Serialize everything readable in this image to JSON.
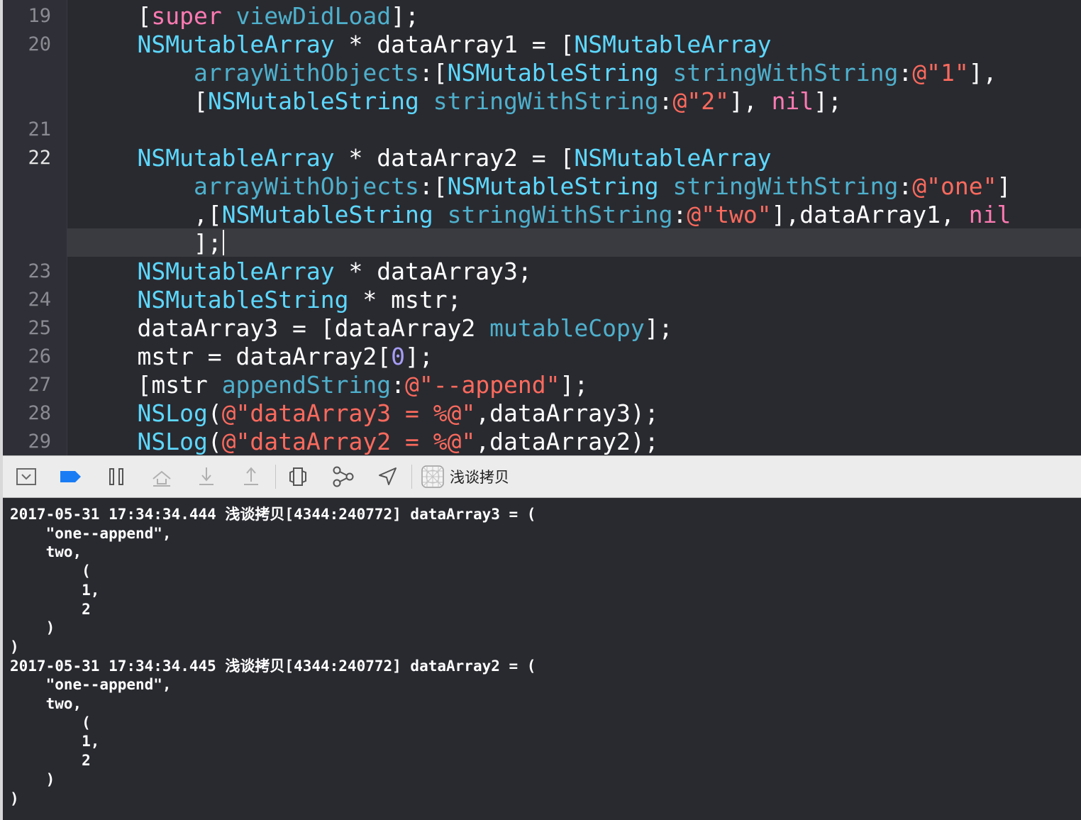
{
  "editor": {
    "current_line": "22",
    "rows": [
      {
        "line": "19",
        "active": false,
        "tokens": [
          [
            "p",
            "    ["
          ],
          [
            "k",
            "super"
          ],
          [
            "p",
            " "
          ],
          [
            "m",
            "viewDidLoad"
          ],
          [
            "p",
            "];"
          ]
        ]
      },
      {
        "line": "20",
        "active": false,
        "tokens": [
          [
            "t",
            "    NSMutableArray"
          ],
          [
            "p",
            " * dataArray1 = ["
          ],
          [
            "t",
            "NSMutableArray"
          ]
        ]
      },
      {
        "line": "",
        "active": false,
        "tokens": [
          [
            "m",
            "        arrayWithObjects"
          ],
          [
            "p",
            ":["
          ],
          [
            "t",
            "NSMutableString"
          ],
          [
            "p",
            " "
          ],
          [
            "m",
            "stringWithString"
          ],
          [
            "p",
            ":"
          ],
          [
            "s",
            "@\"1\""
          ],
          [
            "p",
            "],"
          ]
        ]
      },
      {
        "line": "",
        "active": false,
        "tokens": [
          [
            "p",
            "        ["
          ],
          [
            "t",
            "NSMutableString"
          ],
          [
            "p",
            " "
          ],
          [
            "m",
            "stringWithString"
          ],
          [
            "p",
            ":"
          ],
          [
            "s",
            "@\"2\""
          ],
          [
            "p",
            "], "
          ],
          [
            "k",
            "nil"
          ],
          [
            "p",
            "];"
          ]
        ]
      },
      {
        "line": "21",
        "active": false,
        "tokens": []
      },
      {
        "line": "22",
        "active": true,
        "tokens": [
          [
            "t",
            "    NSMutableArray"
          ],
          [
            "p",
            " * dataArray2 = ["
          ],
          [
            "t",
            "NSMutableArray"
          ]
        ]
      },
      {
        "line": "",
        "active": false,
        "tokens": [
          [
            "m",
            "        arrayWithObjects"
          ],
          [
            "p",
            ":["
          ],
          [
            "t",
            "NSMutableString"
          ],
          [
            "p",
            " "
          ],
          [
            "m",
            "stringWithString"
          ],
          [
            "p",
            ":"
          ],
          [
            "s",
            "@\"one\""
          ],
          [
            "p",
            "]"
          ]
        ]
      },
      {
        "line": "",
        "active": false,
        "tokens": [
          [
            "p",
            "        ,["
          ],
          [
            "t",
            "NSMutableString"
          ],
          [
            "p",
            " "
          ],
          [
            "m",
            "stringWithString"
          ],
          [
            "p",
            ":"
          ],
          [
            "s",
            "@\"two\""
          ],
          [
            "p",
            "],dataArray1, "
          ],
          [
            "k",
            "nil"
          ]
        ]
      },
      {
        "line": "",
        "active": false,
        "cursor": true,
        "tokens": [
          [
            "p",
            "        ];"
          ]
        ]
      },
      {
        "line": "23",
        "active": false,
        "tokens": [
          [
            "t",
            "    NSMutableArray"
          ],
          [
            "p",
            " * dataArray3;"
          ]
        ]
      },
      {
        "line": "24",
        "active": false,
        "tokens": [
          [
            "t",
            "    NSMutableString"
          ],
          [
            "p",
            " * mstr;"
          ]
        ]
      },
      {
        "line": "25",
        "active": false,
        "tokens": [
          [
            "p",
            "    dataArray3 = [dataArray2 "
          ],
          [
            "m",
            "mutableCopy"
          ],
          [
            "p",
            "];"
          ]
        ]
      },
      {
        "line": "26",
        "active": false,
        "tokens": [
          [
            "p",
            "    mstr = dataArray2["
          ],
          [
            "n",
            "0"
          ],
          [
            "p",
            "];"
          ]
        ]
      },
      {
        "line": "27",
        "active": false,
        "tokens": [
          [
            "p",
            "    [mstr "
          ],
          [
            "m",
            "appendString"
          ],
          [
            "p",
            ":"
          ],
          [
            "s",
            "@\"--append\""
          ],
          [
            "p",
            "];"
          ]
        ]
      },
      {
        "line": "28",
        "active": false,
        "tokens": [
          [
            "t",
            "    NSLog"
          ],
          [
            "p",
            "("
          ],
          [
            "s",
            "@\"dataArray3 = %@\""
          ],
          [
            "p",
            ",dataArray3);"
          ]
        ]
      },
      {
        "line": "29",
        "active": false,
        "tokens": [
          [
            "t",
            "    NSLog"
          ],
          [
            "p",
            "("
          ],
          [
            "s",
            "@\"dataArray2 = %@\""
          ],
          [
            "p",
            ",dataArray2);"
          ]
        ]
      }
    ]
  },
  "debug_bar": {
    "target_label": "浅谈拷贝",
    "buttons": [
      {
        "name": "hide-debug-area-button",
        "icon": "panel-toggle-icon"
      },
      {
        "name": "breakpoints-toggle-button",
        "icon": "breakpoint-icon"
      },
      {
        "name": "pause-button",
        "icon": "pause-icon"
      },
      {
        "name": "step-over-button",
        "icon": "step-over-icon"
      },
      {
        "name": "step-into-button",
        "icon": "step-into-icon"
      },
      {
        "name": "step-out-button",
        "icon": "step-out-icon"
      },
      {
        "name": "debug-view-hierarchy-button",
        "icon": "view-hierarchy-icon"
      },
      {
        "name": "memory-graph-button",
        "icon": "memory-graph-icon"
      },
      {
        "name": "simulate-location-button",
        "icon": "location-arrow-icon"
      }
    ],
    "accent_color": "#1a7cf5"
  },
  "console": {
    "lines": [
      "2017-05-31 17:34:34.444 浅谈拷贝[4344:240772] dataArray3 = (",
      "    \"one--append\",",
      "    two,",
      "        (",
      "        1,",
      "        2",
      "    )",
      ")",
      "2017-05-31 17:34:34.445 浅谈拷贝[4344:240772] dataArray2 = (",
      "    \"one--append\",",
      "    two,",
      "        (",
      "        1,",
      "        2",
      "    )",
      ")"
    ]
  }
}
